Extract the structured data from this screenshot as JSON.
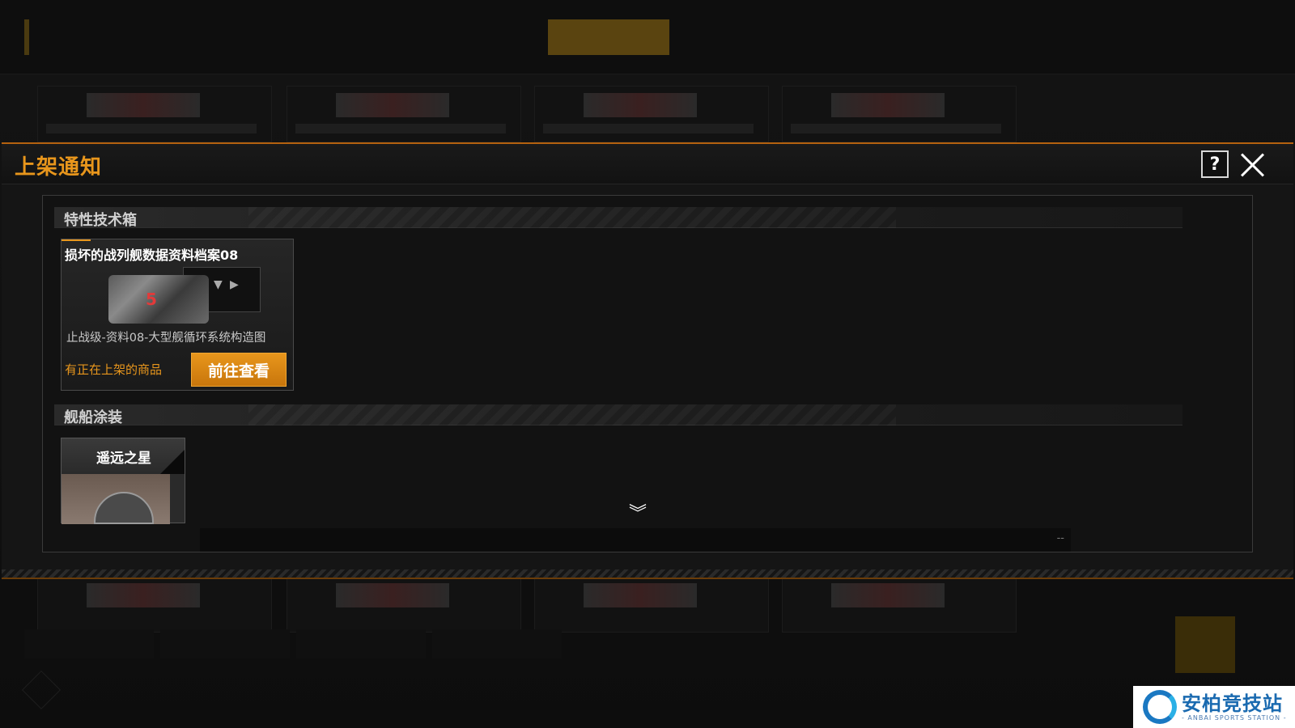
{
  "dialog": {
    "title": "上架通知",
    "help_label": "?"
  },
  "sections": [
    {
      "title": "特性技术箱",
      "items": [
        {
          "name": "损坏的战列舰数据资料档案08",
          "badge": "5",
          "description": "止战级-资料08-大型舰循环系统构造图",
          "status": "有正在上架的商品",
          "action_label": "前往查看"
        }
      ]
    },
    {
      "title": "舰船涂装",
      "items": [
        {
          "name": "遥远之星"
        }
      ]
    }
  ],
  "scroll_icon": "chevron-double-down-icon",
  "footer": {
    "text": "--"
  },
  "watermark": {
    "name": "安柏竞技站",
    "subtitle": "- ANBAI SPORTS STATION -"
  },
  "colors": {
    "accent": "#e8961c",
    "button": "#e8961c",
    "background": "#151515"
  }
}
